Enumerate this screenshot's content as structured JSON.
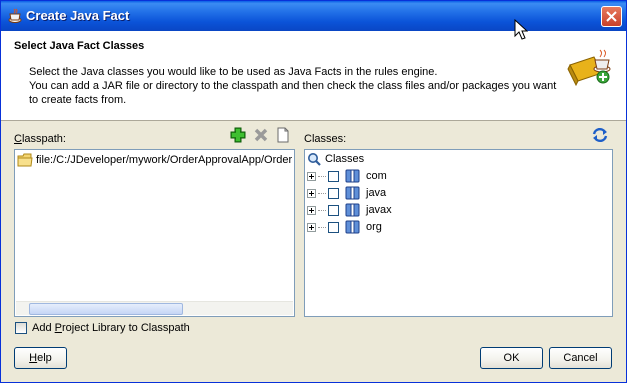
{
  "window": {
    "title": "Create Java Fact",
    "close_icon": "close-icon"
  },
  "header": {
    "title": "Select Java Fact Classes",
    "description_lines": [
      "Select the Java classes you would like to be used as Java Facts in the rules engine.",
      "You can add a JAR file or directory to the classpath and then check the class files and/or packages you want",
      "to create facts from."
    ]
  },
  "classpath": {
    "label_mnemonic": "C",
    "label_rest": "lasspath:",
    "entry": "file:/C:/JDeveloper/mywork/OrderApprovalApp/Order"
  },
  "classes": {
    "label": "Classes:",
    "root": "Classes",
    "packages": [
      "com",
      "java",
      "javax",
      "org"
    ]
  },
  "add_library": {
    "before": "Add ",
    "mnemonic": "P",
    "after": "roject Library to Classpath",
    "checked": false
  },
  "buttons": {
    "help_mnemonic": "H",
    "help_rest": "elp",
    "ok": "OK",
    "cancel": "Cancel"
  },
  "colors": {
    "titlebar": "#0b53d8",
    "dialog_bg": "#ece9d8",
    "close": "#c9402a",
    "add_green": "#2a9d1f"
  }
}
